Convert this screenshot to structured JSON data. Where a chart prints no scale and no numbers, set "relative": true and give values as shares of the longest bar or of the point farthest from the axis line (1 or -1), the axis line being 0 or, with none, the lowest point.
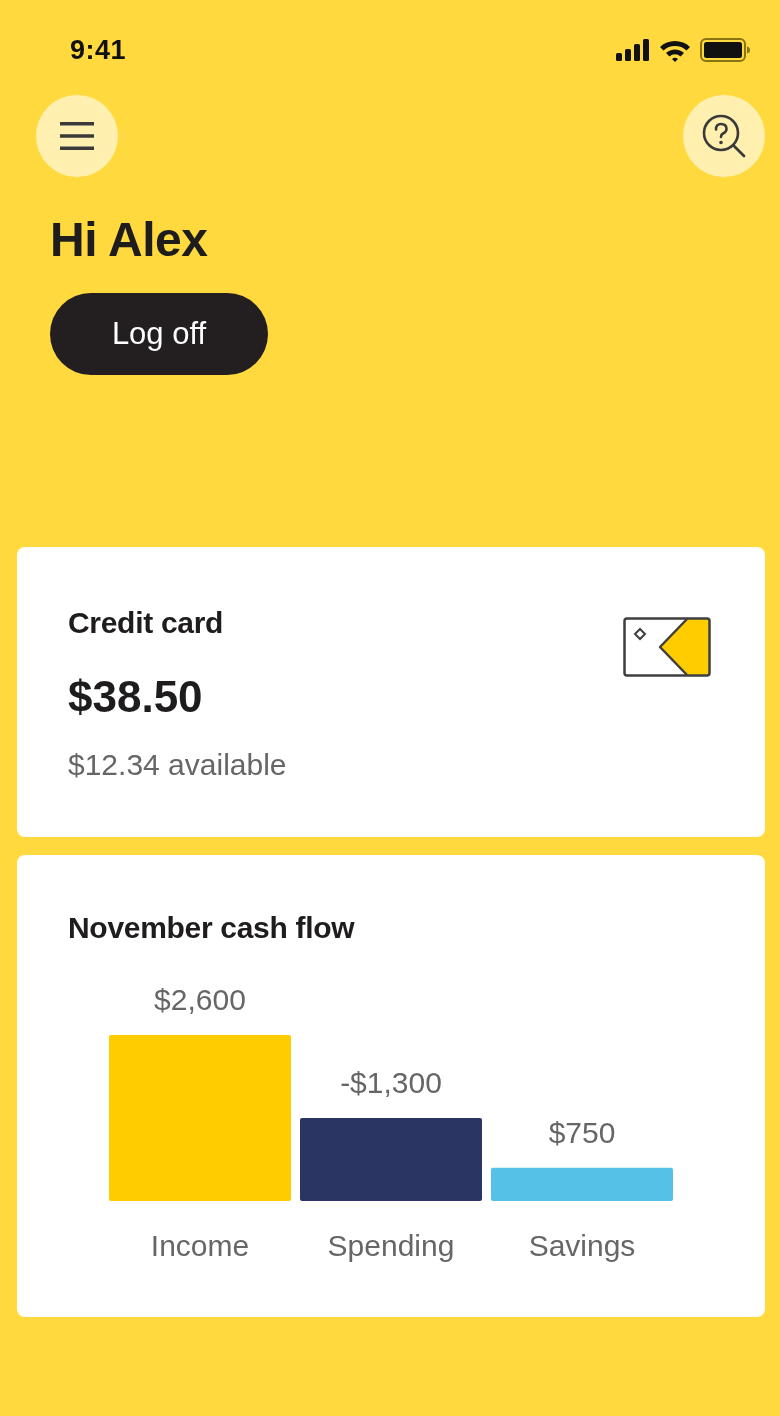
{
  "status_bar": {
    "time": "9:41"
  },
  "header": {
    "greeting": "Hi Alex",
    "log_off_button": "Log off"
  },
  "credit_card": {
    "title": "Credit card",
    "balance": "$38.50",
    "available": "$12.34 available"
  },
  "cash_flow": {
    "title": "November cash flow",
    "amounts": [
      "$2,600",
      "-$1,300",
      "$750"
    ],
    "chart_data": {
      "type": "bar",
      "relative": true,
      "categories": [
        "Income",
        "Spending",
        "Savings"
      ],
      "values": [
        1,
        0.5,
        0.2
      ],
      "colors": [
        "#ffcc00",
        "#2a3564",
        "#55c1e6"
      ]
    }
  }
}
